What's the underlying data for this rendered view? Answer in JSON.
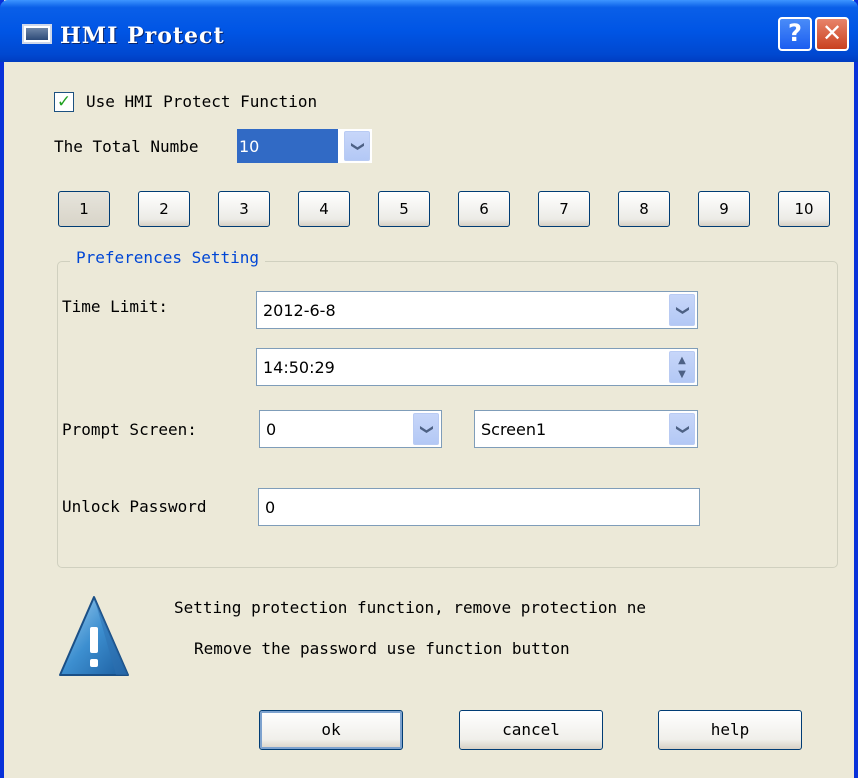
{
  "window": {
    "title": "HMI Protect",
    "help_button": "?",
    "close_button": "✕"
  },
  "use_protect": {
    "checked": true,
    "label": "Use HMI Protect Function"
  },
  "total_number": {
    "label": "The Total Numbe",
    "value": "10"
  },
  "number_buttons": [
    "1",
    "2",
    "3",
    "4",
    "5",
    "6",
    "7",
    "8",
    "9",
    "10"
  ],
  "active_number": "1",
  "preferences": {
    "title": "Preferences Setting",
    "time_limit_label": "Time Limit:",
    "date_value": "2012-6-8",
    "time_value": "14:50:29",
    "prompt_screen_label": "Prompt Screen:",
    "prompt_screen_number": "0",
    "prompt_screen_name": "Screen1",
    "unlock_password_label": "Unlock Password",
    "unlock_password_value": "0"
  },
  "message": {
    "line1": "Setting protection function, remove protection ne",
    "line2": "Remove the password use function button"
  },
  "buttons": {
    "ok": "ok",
    "cancel": "cancel",
    "help": "help"
  },
  "icons": {
    "app": "hmi-window-icon",
    "warning": "warning-triangle-icon",
    "dropdown": "chevron-down-icon",
    "spinner": "up-down-spinner-icon"
  },
  "colors": {
    "titlebar": "#0055e5",
    "window_bg": "#ECE9D8",
    "selection": "#316ac5",
    "group_title": "#0046d5"
  }
}
